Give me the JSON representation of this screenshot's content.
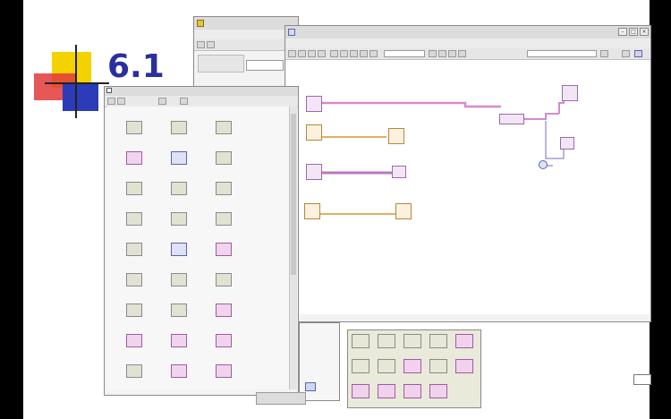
{
  "slide": {
    "title": "6.1",
    "brand_colors": {
      "yellow": "#f4d200",
      "red": "#e23a3a",
      "blue": "#2c3bb8",
      "title": "#2a2fa0"
    }
  },
  "front_panel_window": {
    "icon": "labview-vi-icon",
    "buttons": {
      "minimize": "–",
      "maximize": "□",
      "close": "×"
    }
  },
  "block_diagram_window": {
    "icon": "labview-diagram-icon",
    "buttons": {
      "minimize": "–",
      "maximize": "□",
      "close": "×"
    },
    "wire_colors": {
      "pink": "#d58ad0",
      "orange": "#e2b060",
      "purple": "#9c6aa8"
    }
  },
  "functions_palette": {
    "icon": "pin-icon",
    "items": [
      {
        "icon": "function-icon",
        "tone": "plain"
      },
      {
        "icon": "loop-structure-icon",
        "tone": "plain"
      },
      {
        "icon": "case-structure-icon",
        "tone": "plain"
      },
      {
        "icon": "numeric-icon",
        "tone": "pink"
      },
      {
        "icon": "boolean-icon",
        "tone": "blue"
      },
      {
        "icon": "string-icon",
        "tone": "plain"
      },
      {
        "icon": "array-icon",
        "tone": "plain"
      },
      {
        "icon": "cluster-icon",
        "tone": "plain"
      },
      {
        "icon": "comparison-icon",
        "tone": "plain"
      },
      {
        "icon": "timing-icon",
        "tone": "plain"
      },
      {
        "icon": "dialog-icon",
        "tone": "plain"
      },
      {
        "icon": "file-io-icon",
        "tone": "plain"
      },
      {
        "icon": "waveform-icon",
        "tone": "plain"
      },
      {
        "icon": "analyze-icon",
        "tone": "blue"
      },
      {
        "icon": "instrument-io-icon",
        "tone": "pink"
      },
      {
        "icon": "mathematics-icon",
        "tone": "plain"
      },
      {
        "icon": "signal-processing-icon",
        "tone": "plain"
      },
      {
        "icon": "data-communication-icon",
        "tone": "plain"
      },
      {
        "icon": "connectivity-icon",
        "tone": "plain"
      },
      {
        "icon": "control-design-icon",
        "tone": "plain"
      },
      {
        "icon": "express-icon",
        "tone": "pink"
      },
      {
        "icon": "addons-icon",
        "tone": "pink"
      },
      {
        "icon": "favorites-icon",
        "tone": "pink"
      },
      {
        "icon": "user-libraries-icon",
        "tone": "pink"
      },
      {
        "icon": "select-vi-icon",
        "tone": "plain"
      },
      {
        "icon": "fpga-icon",
        "tone": "pink"
      },
      {
        "icon": "vision-icon",
        "tone": "pink"
      }
    ]
  },
  "sub_palette": {
    "cells": [
      {
        "icon": "read-icon",
        "tone": "plain"
      },
      {
        "icon": "write-icon",
        "tone": "plain"
      },
      {
        "icon": "config-icon",
        "tone": "plain"
      },
      {
        "icon": "close-file-icon",
        "tone": "plain"
      },
      {
        "icon": "numeric-const-icon",
        "tone": "pink"
      },
      {
        "icon": "add-icon",
        "tone": "plain"
      },
      {
        "icon": "subtract-icon",
        "tone": "plain"
      },
      {
        "icon": "multiply-icon",
        "tone": "pink"
      },
      {
        "icon": "divide-icon",
        "tone": "plain"
      },
      {
        "icon": "increment-icon",
        "tone": "pink"
      },
      {
        "icon": "decrement-icon",
        "tone": "pink"
      },
      {
        "icon": "absolute-icon",
        "tone": "pink"
      },
      {
        "icon": "round-icon",
        "tone": "pink"
      },
      {
        "icon": "sqrt-icon",
        "tone": "pink"
      }
    ]
  }
}
